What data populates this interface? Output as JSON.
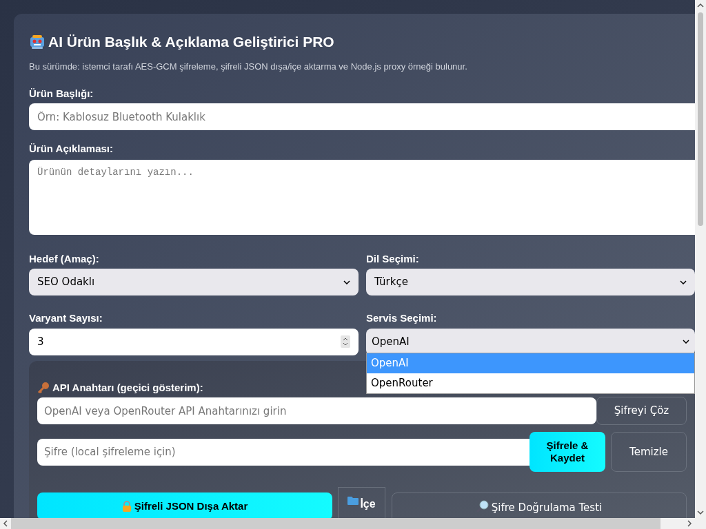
{
  "app": {
    "title": "AI Ürün Başlık & Açıklama Geliştirici PRO",
    "subtitle": "Bu sürümde: istemci tarafı AES-GCM şifreleme, şifreli JSON dışa/içe aktarma ve Node.js proxy örneği bulunur."
  },
  "title_field": {
    "label": "Ürün Başlığı:",
    "placeholder": "Örn: Kablosuz Bluetooth Kulaklık"
  },
  "description_field": {
    "label": "Ürün Açıklaması:",
    "placeholder": "Ürünün detaylarını yazın..."
  },
  "goal_select": {
    "label": "Hedef (Amaç):",
    "value": "SEO Odaklı"
  },
  "language_select": {
    "label": "Dil Seçimi:",
    "value": "Türkçe"
  },
  "variant_field": {
    "label": "Varyant Sayısı:",
    "value": "3"
  },
  "service_select": {
    "label": "Servis Seçimi:",
    "value": "OpenAI",
    "expanded": true,
    "options": [
      {
        "label": "OpenAI",
        "selected": true
      },
      {
        "label": "OpenRouter",
        "selected": false
      }
    ]
  },
  "api_panel": {
    "label": "API Anahtarı (geçici gösterim):",
    "api_key_placeholder": "OpenAI veya OpenRouter API Anahtarınızı girin",
    "decrypt_button": "Şifreyi Çöz",
    "password_placeholder": "Şifre (local şifreleme için)",
    "encrypt_button": "Şifrele & Kaydet",
    "clear_button": "Temizle",
    "export_button": "Şifreli JSON Dışa Aktar",
    "import_button": "İçe",
    "test_button": "Şifre Doğrulama Testi"
  }
}
